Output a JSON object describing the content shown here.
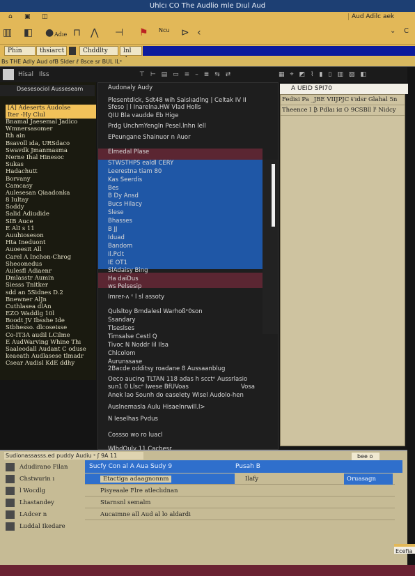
{
  "window": {
    "title": "Uhlcı CO The Audlio mle Dıul Aud"
  },
  "menubar": {
    "right_label": "Aud Adilc aek"
  },
  "toolbar": {
    "items": [
      "Adıe",
      "Ncu"
    ]
  },
  "tabs": [
    {
      "label": "Phin"
    },
    {
      "label": "thsiarct"
    },
    {
      "label": "Chddlty"
    },
    {
      "label": "lnl de"
    }
  ],
  "status_strip": "Bs THE Adly Aud ofB Slder ℓ 8sce sr BUL ILᵉ",
  "dark_toolbar": {
    "label1": "Hisal",
    "label2": "Ilss"
  },
  "left_panel": {
    "header": "Dsesesociol Ausseseam",
    "selected": [
      "[A] Adeserts Audolse",
      "Iter -Hy Clul"
    ],
    "items": [
      "Bnamal Jaesemal Jadico",
      "Wmnersasomer",
      "Ith ain",
      "Bsavoll ıda, URSdaco",
      "Swavdk Jmanmasma",
      "Nerne Ihal Hinesoc",
      "Sukas",
      "Hadachutt",
      "Borvany",
      "Camcasy",
      "Aulesesan Qiaadonka",
      "8 Iultay",
      "Soddy",
      "Salid Adiudide",
      "SIB Auce",
      "E AlI s 11",
      "Auuhioseson",
      "Hta Ineduont",
      "Auoeesit All",
      "Carel A Inchon-Chrog",
      "Sheoonedus",
      "Aulesfl Adiaenr",
      "Dmlasstr Aumin",
      "Siesss Tnitker",
      "sdd an 5Sidnes D.2",
      "Bnewner AlJn",
      "Cuthlasea dlAn",
      "EZO Waddlg 10l",
      "Boodt JV Ibsshe Ide",
      "Stbhesso. dlcoseisse",
      "Co-IT3A audil LCilme",
      "E AudWarving Whine Thı",
      "Saaleodall Audant C oduse",
      "keaeath Audlasese tlmadr",
      "Csear Audisl KdE ddhy"
    ]
  },
  "dropdown_menu": {
    "items": [
      {
        "label": "Audonaly Audy"
      },
      {
        "label": "Plesentdick, Sdt48 wih Saislıadlng | Celtak IV II"
      },
      {
        "label": "Sfeso  |  l  Inarelna.HW Vlad Holls"
      },
      {
        "label": "QIU Bla vaudde Eb Hige"
      },
      {
        "label": "Prdg UnchmYengln  Pesel.lnhn lell"
      },
      {
        "label": "EPeungane Shainuor n Auor"
      },
      {
        "label": "Elmedal Plase"
      },
      {
        "label": "STWSTHPS ealdl CERY"
      },
      {
        "label": "Leerestna tiam 80"
      },
      {
        "label": "Kas Seerdis"
      },
      {
        "label": "Bes"
      },
      {
        "label": "B Dy Ansd"
      },
      {
        "label": "Bucs Hilacy"
      },
      {
        "label": "Slese"
      },
      {
        "label": "Bhasses"
      },
      {
        "label": "B JJ"
      },
      {
        "label": "Iduad"
      },
      {
        "label": "Bandom"
      },
      {
        "label": "Il.Pclt"
      },
      {
        "label": "IE OT1"
      },
      {
        "label": "SlAdaisy Bing"
      },
      {
        "label": "Ha daiDus"
      },
      {
        "label": "ws Pelsesip"
      },
      {
        "label": "Imrer-ʌ ˢ l sl assoty"
      },
      {
        "label": "Qulsltoy Bmdalesl Warhoßᵉ0son"
      },
      {
        "label": "Ssandary"
      },
      {
        "label": "Tlseslses"
      },
      {
        "label": "Timsalse Cestl Q"
      },
      {
        "label": "Tivoc N Noddr Iil Ilsa"
      },
      {
        "label": "Chlcolom"
      },
      {
        "label": "Aurunssase"
      },
      {
        "label": "2Bacde odditsy roadane 8 Aussaanblug"
      },
      {
        "label": "Oeco aucing TLTAN 118 adas h scctᵉ Aussrlasio"
      },
      {
        "label": "sun1 0 Llscᵉ Iwese BfUVoas",
        "right": "Vosa"
      },
      {
        "label": "Anek lao Sounh do easelety Wisel Audolo-hen"
      },
      {
        "label": "Auslnemasla Aulu Hisaelnrwill.l>"
      },
      {
        "label": "N  Ieselhas Pvdus"
      },
      {
        "label": "Cossso wo ro luacl"
      },
      {
        "label": "WlhdOuly   11    Cachesr"
      }
    ]
  },
  "right_panel": {
    "dropdown_value": "A UEID SPI70",
    "rows": [
      "Fedisi Pa _JBE VIIJPJC ŧ'ɪdsr Glahal 5n",
      "Theence I  ₿ Pdlaı iɑ O 9CSBll lᵗ Nidcy"
    ]
  },
  "bottom_panel": {
    "header": "Sudionassasss.ed puddy Audiu ˢ ʃ 9A 11",
    "right_label": "bee o",
    "tree": [
      "Adudirano Filan",
      "Chstwurin ı",
      "l Wocdlg",
      "Lhastandey",
      "LAdcer n",
      "Luddal Ikedare"
    ],
    "selected_row": {
      "name": "Sucfy Con al A Aua Sudy 9",
      "col2": "Pusah B"
    },
    "rows": [
      {
        "name": "Etactiga adaagnonnm",
        "col2": "Ilafy",
        "col3": "Oruasagn"
      },
      {
        "name": "Pisyeaale Flre atleclıdnan"
      },
      {
        "name": "Starnsnl semalm"
      },
      {
        "name": "Aucaimne all Aud al lo aldardi"
      }
    ],
    "corner_label": "Ecefia"
  },
  "colors": {
    "title_bar": "#1d3f73",
    "toolbar": "#e2b858",
    "selection": "#1f57a6",
    "maroon": "#5b2632",
    "panel": "#c6bb95"
  }
}
